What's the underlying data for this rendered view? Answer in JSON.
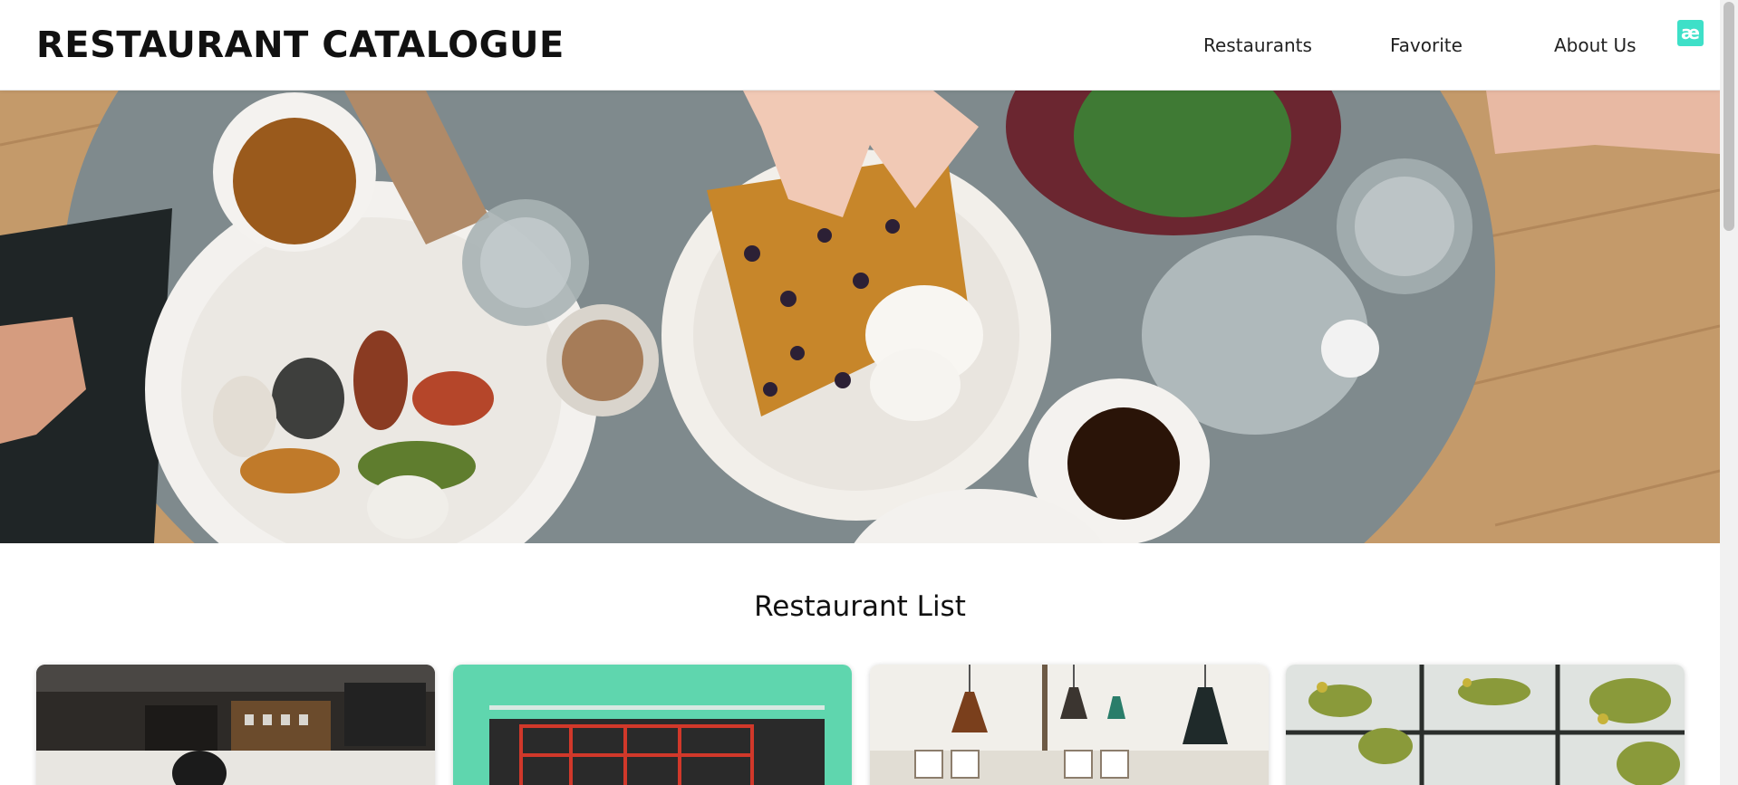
{
  "header": {
    "brand": "RESTAURANT CATALOGUE",
    "nav": [
      "Restaurants",
      "Favorite",
      "About Us"
    ],
    "extension_icon": "ae-ligature-icon",
    "extension_label": "æ"
  },
  "hero": {
    "image_description_icon": "hero-food-table-image"
  },
  "main": {
    "list_title": "Restaurant List"
  },
  "restaurants": [
    {
      "thumbnail": "cafe-interior-image"
    },
    {
      "thumbnail": "mint-storefront-image"
    },
    {
      "thumbnail": "pendant-lamps-image"
    },
    {
      "thumbnail": "greenhouse-plants-image"
    }
  ],
  "colors": {
    "accent": "#3ee0c8",
    "table": "#7f8a8d",
    "wood": "#c49a6a"
  }
}
